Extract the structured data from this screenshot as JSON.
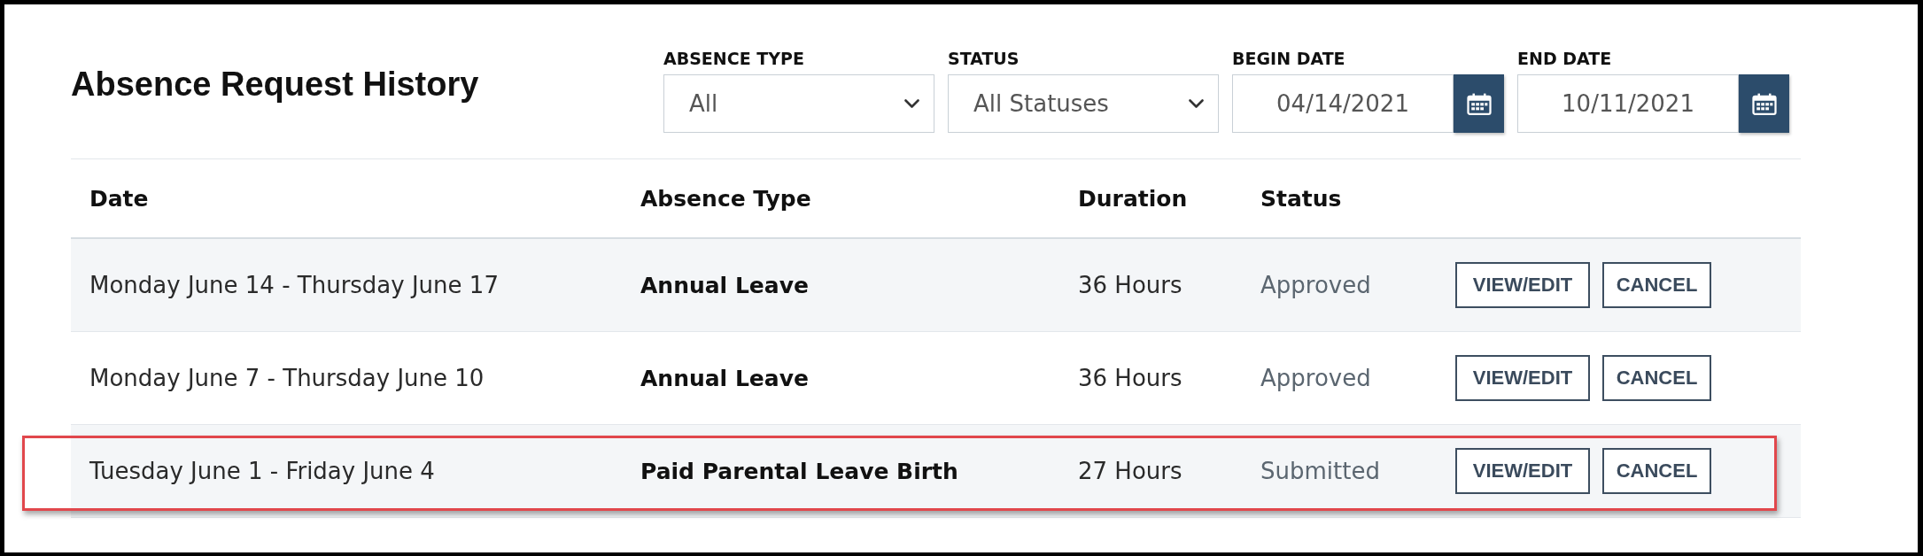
{
  "title": "Absence Request History",
  "filters": [
    {
      "kind": "select",
      "label": "ABSENCE TYPE",
      "value": "All"
    },
    {
      "kind": "select",
      "label": "STATUS",
      "value": "All Statuses"
    },
    {
      "kind": "date",
      "label": "BEGIN DATE",
      "value": "04/14/2021"
    },
    {
      "kind": "date",
      "label": "END DATE",
      "value": "10/11/2021"
    }
  ],
  "table": {
    "columns": [
      "Date",
      "Absence Type",
      "Duration",
      "Status"
    ],
    "rows": [
      {
        "date": "Monday June 14 - Thursday June 17",
        "absence_type": "Annual Leave",
        "duration": "36 Hours",
        "status": "Approved",
        "actions": [
          {
            "kind": "view_edit",
            "label": "VIEW/EDIT"
          },
          {
            "kind": "cancel",
            "label": "CANCEL"
          }
        ],
        "highlighted": false
      },
      {
        "date": "Monday June 7 - Thursday June 10",
        "absence_type": "Annual Leave",
        "duration": "36 Hours",
        "status": "Approved",
        "actions": [
          {
            "kind": "view_edit",
            "label": "VIEW/EDIT"
          },
          {
            "kind": "cancel",
            "label": "CANCEL"
          }
        ],
        "highlighted": false
      },
      {
        "date": "Tuesday June 1 - Friday June 4",
        "absence_type": "Paid Parental Leave Birth",
        "duration": "27 Hours",
        "status": "Submitted",
        "actions": [
          {
            "kind": "view_edit",
            "label": "VIEW/EDIT"
          },
          {
            "kind": "cancel",
            "label": "CANCEL"
          }
        ],
        "highlighted": true
      }
    ]
  }
}
